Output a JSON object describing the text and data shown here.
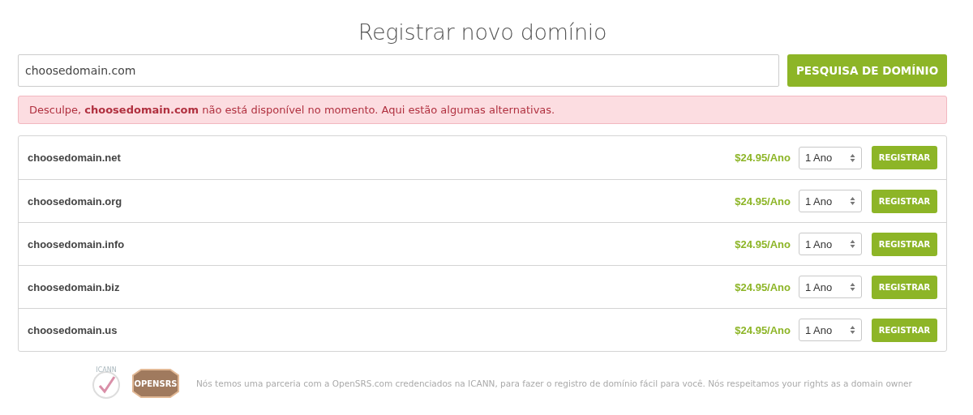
{
  "title": "Registrar novo domínio",
  "search": {
    "value": "choosedomain.com",
    "button": "PESQUISA DE DOMÍNIO"
  },
  "alert": "Desculpe, **choosedomain.com** não está disponível no momento. Aqui estão algumas alternativas.",
  "results": [
    {
      "domain": "choosedomain.net",
      "price": "$24.95/Ano",
      "period": "1 Ano",
      "button": "REGISTRAR"
    },
    {
      "domain": "choosedomain.org",
      "price": "$24.95/Ano",
      "period": "1 Ano",
      "button": "REGISTRAR"
    },
    {
      "domain": "choosedomain.info",
      "price": "$24.95/Ano",
      "period": "1 Ano",
      "button": "REGISTRAR"
    },
    {
      "domain": "choosedomain.biz",
      "price": "$24.95/Ano",
      "period": "1 Ano",
      "button": "REGISTRAR"
    },
    {
      "domain": "choosedomain.us",
      "price": "$24.95/Ano",
      "period": "1 Ano",
      "button": "REGISTRAR"
    }
  ],
  "footer": {
    "badges": [
      "ICANN",
      "OPENSRS"
    ],
    "text": "Nós temos uma parceria com a OpenSRS.com credenciados na ICANN, para fazer o registro de domínio fácil para você. Nós respeitamos your rights as a domain owner"
  }
}
